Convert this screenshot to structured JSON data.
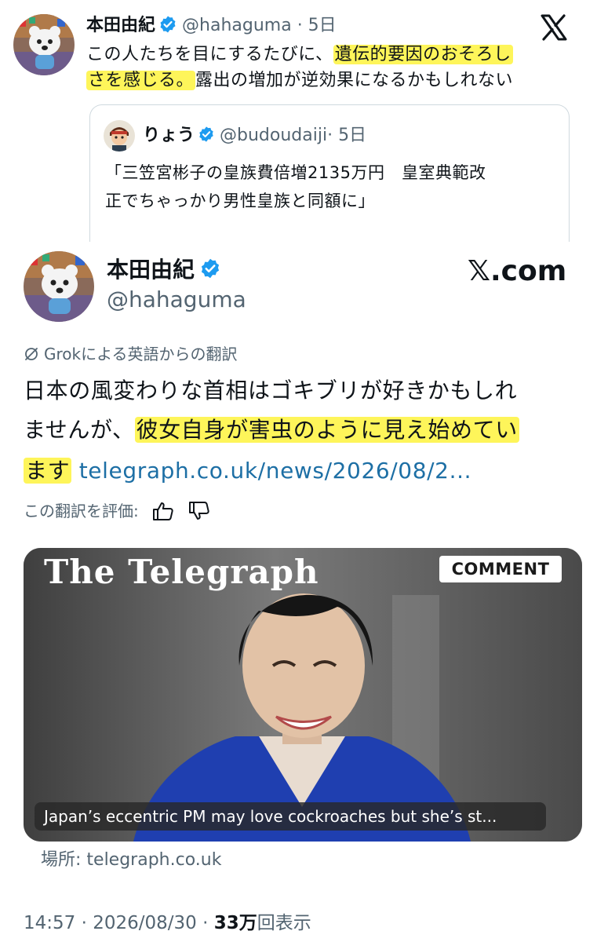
{
  "top_tweet": {
    "name": "本田由紀",
    "handle": "@hahaguma",
    "time": "· 5日",
    "line1_plain": "この人たちを目にするたびに、",
    "line1_highlight": "遺伝的要因のおそろし",
    "line2_highlight": "さを感じる。",
    "line2_plain": "露出の増加が逆効果になるかもしれない",
    "logo_icon": "x-logo-icon"
  },
  "quoted_tweet": {
    "name": "りょう",
    "handle": "@budoudaiji",
    "time": "· 5日",
    "line1": "「三笠宮彬子の皇族費倍増2135万円　皇室典範改",
    "line2": "正でちゃっかり男性皇族と同額に」"
  },
  "bottom_card": {
    "name": "本田由紀",
    "handle": "@hahaguma",
    "brand": "𝕏.com",
    "translation_note": "Grokによる英語からの翻訳",
    "line1": "日本の風変わりな首相はゴキブリが好きかもしれ",
    "line2_plain": "ませんが、",
    "line2_highlight": "彼女自身が害虫のように見え始めてい",
    "line3_highlight": "ます",
    "line3_link": "telegraph.co.uk/news/2026/08/2...",
    "rate_label": "この翻訳を評価:",
    "media": {
      "wordmark": "The Telegraph",
      "badge": "COMMENT",
      "caption": "Japan’s eccentric PM may love cockroaches but she’s st..."
    },
    "source": "場所: telegraph.co.uk",
    "timestamp": "14:57 · 2026/08/30 · ",
    "views_number": "33万",
    "views_label": "回表示"
  },
  "colors": {
    "highlight": "#fef55a",
    "verified": "#1d9bf0",
    "link": "#1d6fa5",
    "secondary_text": "#536471"
  }
}
